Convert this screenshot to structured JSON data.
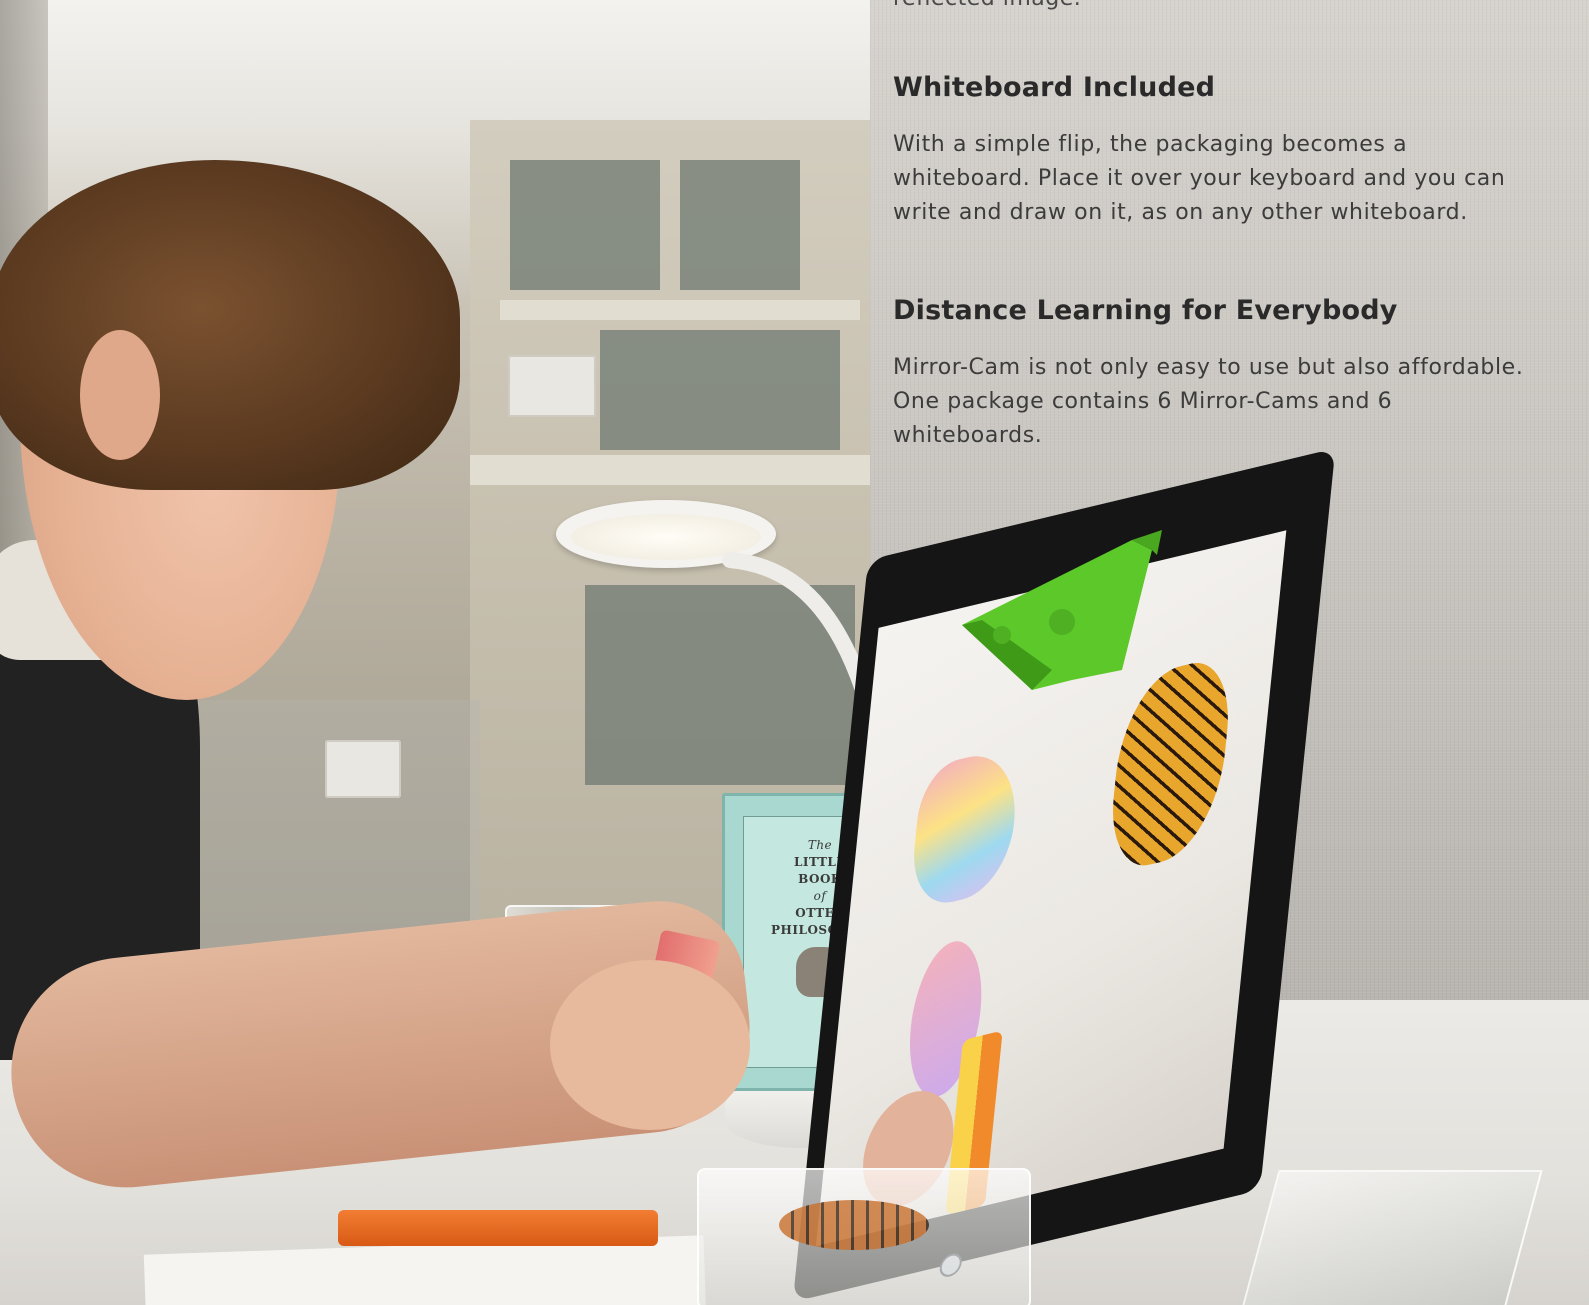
{
  "top_fragment": "reflected image.",
  "sections": [
    {
      "heading": "Whiteboard Included",
      "lines": [
        "With a simple flip, the packaging becomes a",
        "whiteboard. Place it over your keyboard and you can",
        "write and draw on it, as on any other whiteboard."
      ]
    },
    {
      "heading": "Distance Learning for Everybody",
      "lines": [
        "Mirror-Cam is not only easy to use but also affordable.",
        "One package contains 6 Mirror-Cams and 6",
        "whiteboards."
      ]
    }
  ],
  "book": {
    "lines": [
      "The",
      "LITTLE",
      "BOOK",
      "of",
      "OTTER",
      "PHILOSOPHY"
    ]
  },
  "colors": {
    "mirror_cam_green": "#5cc82a",
    "heading_text": "#2a2a2a",
    "body_text": "#3c3c3c"
  }
}
